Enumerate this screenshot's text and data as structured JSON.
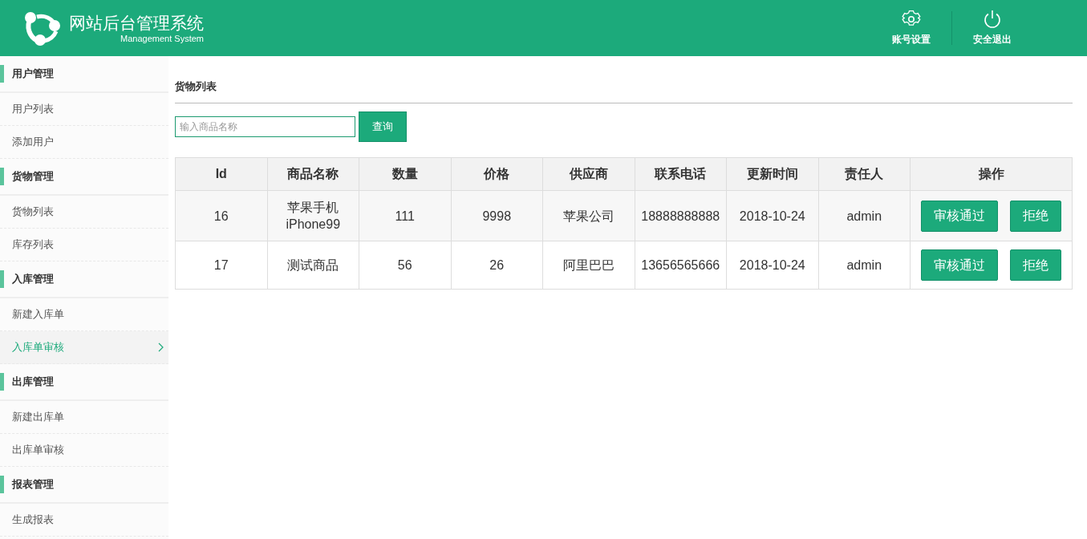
{
  "header": {
    "title": "网站后台管理系统",
    "subtitle": "Management System",
    "actions": [
      {
        "kind": "settings",
        "label": "账号设置"
      },
      {
        "kind": "logout",
        "label": "安全退出"
      }
    ]
  },
  "sidebar": {
    "groups": [
      {
        "title": "用户管理",
        "items": [
          {
            "label": "用户列表",
            "selected": false
          },
          {
            "label": "添加用户",
            "selected": false
          }
        ]
      },
      {
        "title": "货物管理",
        "items": [
          {
            "label": "货物列表",
            "selected": false
          },
          {
            "label": "库存列表",
            "selected": false
          }
        ]
      },
      {
        "title": "入库管理",
        "items": [
          {
            "label": "新建入库单",
            "selected": false
          },
          {
            "label": "入库单审核",
            "selected": true
          }
        ]
      },
      {
        "title": "出库管理",
        "items": [
          {
            "label": "新建出库单",
            "selected": false
          },
          {
            "label": "出库单审核",
            "selected": false
          }
        ]
      },
      {
        "title": "报表管理",
        "items": [
          {
            "label": "生成报表",
            "selected": false
          }
        ]
      }
    ]
  },
  "main": {
    "title": "货物列表",
    "search": {
      "placeholder": "输入商品名称"
    },
    "search_button": "查询",
    "table": {
      "columns": [
        "Id",
        "商品名称",
        "数量",
        "价格",
        "供应商",
        "联系电话",
        "更新时间",
        "责任人",
        "操作"
      ],
      "rows": [
        {
          "cells": [
            "16",
            "苹果手机iPhone99",
            "111",
            "9998",
            "苹果公司",
            "18888888888",
            "2018-10-24",
            "admin"
          ],
          "actions": [
            "审核通过",
            "拒绝"
          ]
        },
        {
          "cells": [
            "17",
            "测试商品",
            "56",
            "26",
            "阿里巴巴",
            "13656565666",
            "2018-10-24",
            "admin"
          ],
          "actions": [
            "审核通过",
            "拒绝"
          ]
        }
      ]
    }
  }
}
